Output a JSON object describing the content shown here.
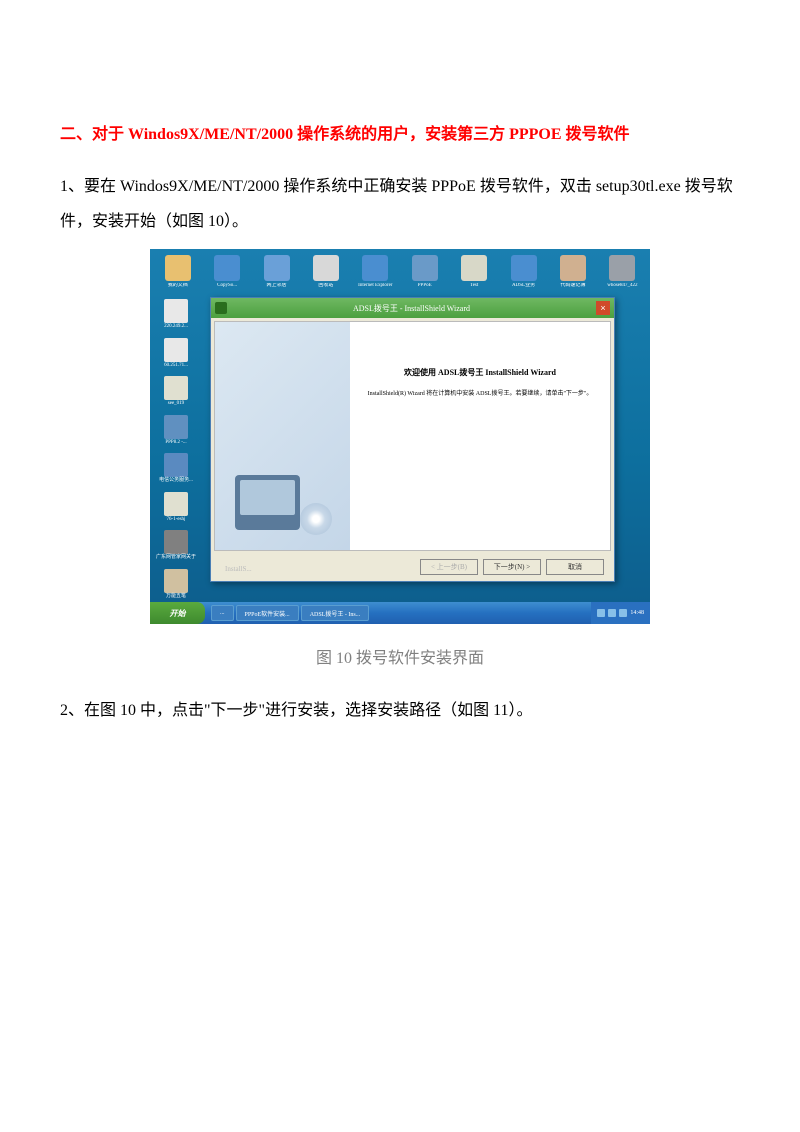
{
  "heading": "二、对于 Windos9X/ME/NT/2000 操作系统的用户，安装第三方 PPPOE 拨号软件",
  "para1": "1、要在 Windos9X/ME/NT/2000 操作系统中正确安装 PPPoE 拨号软件，双击 setup30tl.exe 拨号软件，安装开始（如图 10）。",
  "caption": "图 10 拨号软件安装界面",
  "para2": "2、在图 10 中，点击\"下一步\"进行安装，选择安装路径（如图 11）。",
  "screenshot": {
    "desktop_icons": [
      {
        "label": "我的文档",
        "color": "#e8c070"
      },
      {
        "label": "CopySo...",
        "color": "#4a8ed0"
      },
      {
        "label": "网上邻居",
        "color": "#6aa0d8"
      },
      {
        "label": "回收站",
        "color": "#d8d8d8"
      },
      {
        "label": "Internet Explorer",
        "color": "#4a8ed0"
      },
      {
        "label": "PPPoE",
        "color": "#6a9ac8"
      },
      {
        "label": "Test",
        "color": "#d8d8c8"
      },
      {
        "label": "ADSL业务",
        "color": "#4a8ed0"
      },
      {
        "label": "代码速记簿",
        "color": "#d0b090"
      },
      {
        "label": "whose847_422",
        "color": "#9aa0a8"
      }
    ],
    "left_icons": [
      {
        "label": "220.249.2...",
        "color": "#e8e8e8"
      },
      {
        "label": "60.251.71...",
        "color": "#e8e8e8"
      },
      {
        "label": "see_019",
        "color": "#e0e0d0"
      },
      {
        "label": "PPP8.2 -...",
        "color": "#6090c0"
      },
      {
        "label": "电信公务服务...",
        "color": "#5a8ac0"
      },
      {
        "label": "76-1-eshj",
        "color": "#e0e0d0"
      },
      {
        "label": "广东网管家网关于",
        "color": "#808080"
      },
      {
        "label": "万能五笔",
        "color": "#d0c0a0"
      }
    ],
    "wizard": {
      "title": "ADSL拨号王 - InstallShield Wizard",
      "heading": "欢迎使用 ADSL拨号王 InstallShield Wizard",
      "text": "InstallShield(R) Wizard 将在计算机中安装 ADSL拨号王。若要继续，请单击\"下一步\"。",
      "install_label": "InstallS...",
      "btn_back": "< 上一步(B)",
      "btn_next": "下一步(N) >",
      "btn_cancel": "取消"
    },
    "taskbar": {
      "start": "开始",
      "items": [
        "...",
        "PPPoE软件安装...",
        "ADSL拨号王 - Ins..."
      ],
      "clock": "14:48"
    }
  }
}
